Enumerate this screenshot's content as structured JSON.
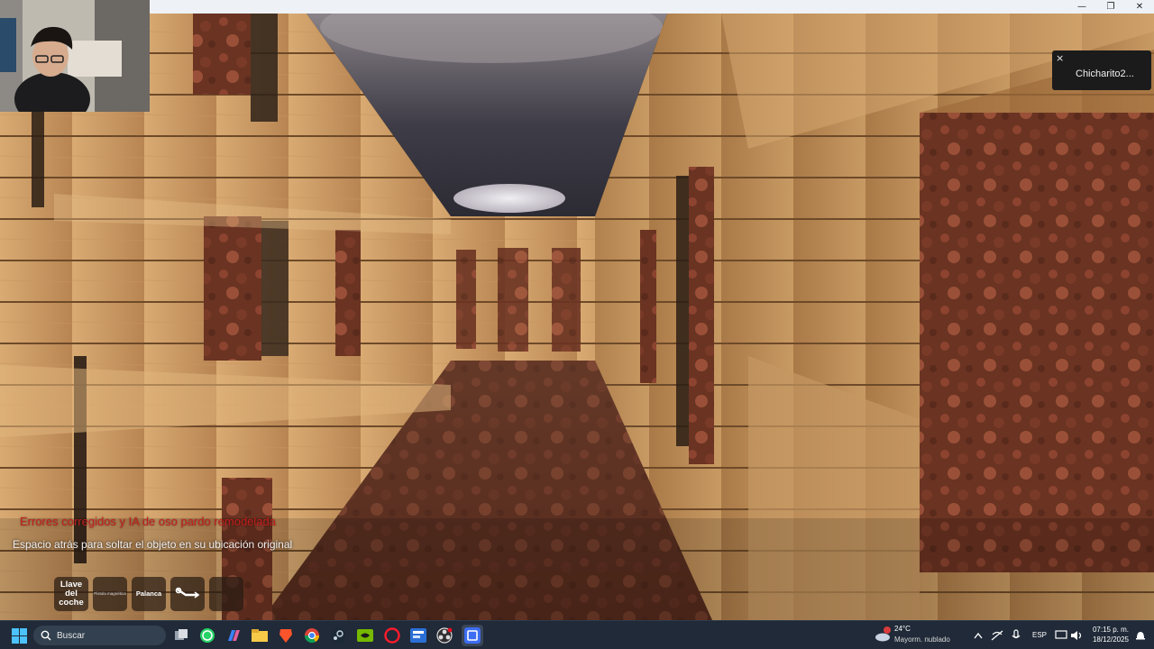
{
  "window": {
    "controls": {
      "minimize": "—",
      "restore": "❐",
      "close": "✕"
    }
  },
  "webcam": {
    "icon": "webcam-person"
  },
  "toast": {
    "close_label": "×",
    "text": "Chicharito2..."
  },
  "hud": {
    "notification_line": "Errores corregidos y IA de oso pardo remodelada",
    "hint_line": "Espacio atrás para soltar el objeto en su ubicación original",
    "notification_color": "#c41e1e",
    "inventory": [
      {
        "label": "Llave del coche",
        "size": "big"
      },
      {
        "label": "Pistola magnética",
        "size": "small"
      },
      {
        "label": "Palanca",
        "size": "med"
      },
      {
        "label": "",
        "icon": "wrench-icon"
      },
      {
        "label": ""
      }
    ]
  },
  "taskbar": {
    "search_label": "Buscar",
    "apps": [
      "start-icon",
      "task-view-icon",
      "whatsapp-icon",
      "copilot-icon",
      "file-explorer-icon",
      "brave-icon",
      "chrome-icon",
      "steam-icon",
      "nvidia-icon",
      "opera-icon",
      "app-icon",
      "obs-icon",
      "active-app-icon"
    ],
    "weather": {
      "temp": "24°C",
      "condition": "Mayorm. nublado",
      "badge": "1"
    },
    "tray": {
      "language": "ESP"
    },
    "clock": {
      "time": "07:15 p. m.",
      "date": "18/12/2025"
    }
  }
}
